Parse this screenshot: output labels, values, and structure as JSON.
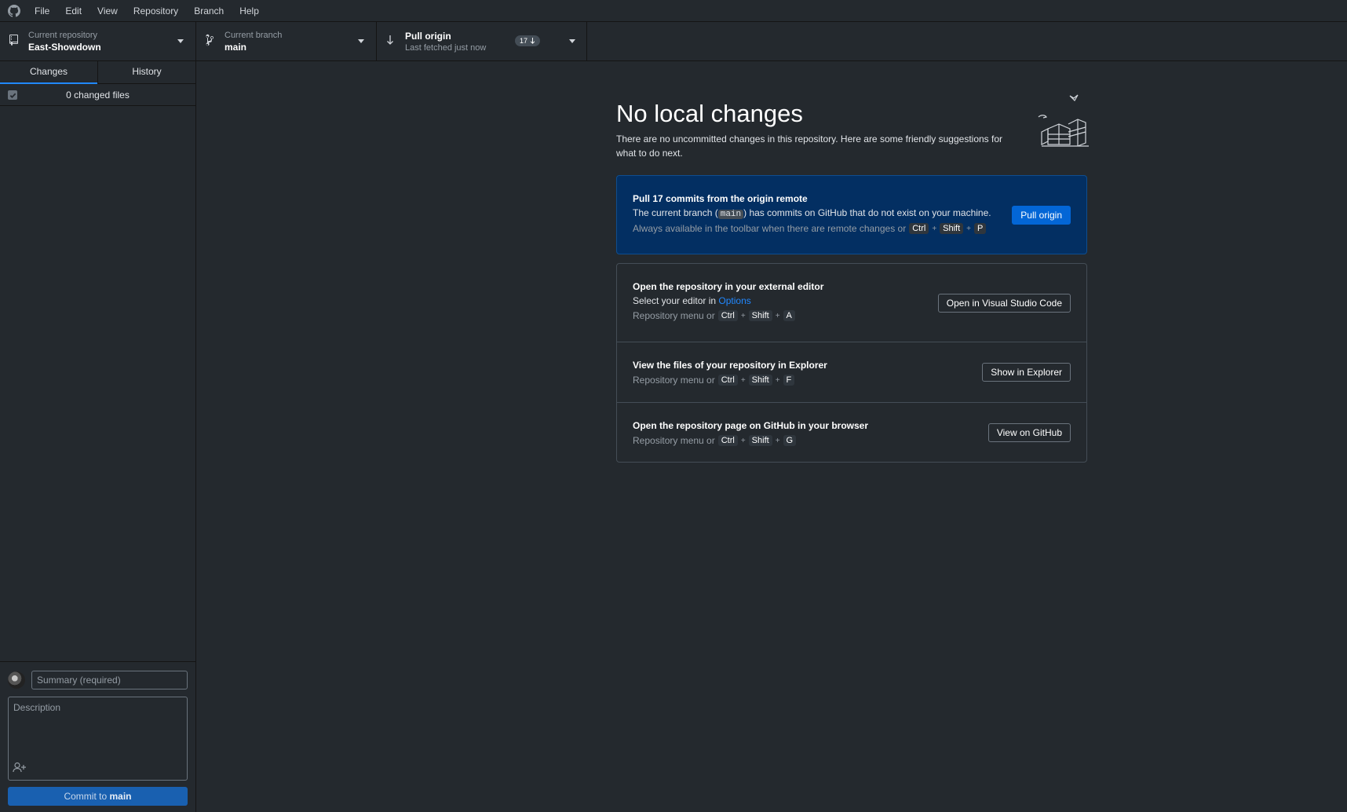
{
  "menubar": {
    "items": [
      "File",
      "Edit",
      "View",
      "Repository",
      "Branch",
      "Help"
    ]
  },
  "toolbar": {
    "repository": {
      "label": "Current repository",
      "value": "East-Showdown",
      "icon": "repo-icon"
    },
    "branch": {
      "label": "Current branch",
      "value": "main",
      "icon": "git-branch-icon"
    },
    "pull": {
      "label": "Pull origin",
      "sublabel": "Last fetched just now",
      "badge_count": "17",
      "icon": "arrow-down-icon"
    }
  },
  "sidebar": {
    "tabs": [
      {
        "label": "Changes",
        "active": true
      },
      {
        "label": "History",
        "active": false
      }
    ],
    "changed_files": "0 changed files",
    "commit": {
      "summary_placeholder": "Summary (required)",
      "description_placeholder": "Description",
      "button_prefix": "Commit to",
      "button_branch": "main"
    }
  },
  "main": {
    "title": "No local changes",
    "description": "There are no uncommitted changes in this repository. Here are some friendly suggestions for what to do next.",
    "pull_card": {
      "title": "Pull 17 commits from the origin remote",
      "desc_before": "The current branch (",
      "branch": "main",
      "desc_after": ") has commits on GitHub that do not exist on your machine.",
      "hint": "Always available in the toolbar when there are remote changes or",
      "keys": [
        "Ctrl",
        "Shift",
        "P"
      ],
      "button": "Pull origin"
    },
    "editor_card": {
      "title": "Open the repository in your external editor",
      "desc_before": "Select your editor in",
      "desc_link": "Options",
      "hint": "Repository menu or",
      "keys": [
        "Ctrl",
        "Shift",
        "A"
      ],
      "button": "Open in Visual Studio Code"
    },
    "explorer_card": {
      "title": "View the files of your repository in Explorer",
      "hint": "Repository menu or",
      "keys": [
        "Ctrl",
        "Shift",
        "F"
      ],
      "button": "Show in Explorer"
    },
    "github_card": {
      "title": "Open the repository page on GitHub in your browser",
      "hint": "Repository menu or",
      "keys": [
        "Ctrl",
        "Shift",
        "G"
      ],
      "button": "View on GitHub"
    }
  },
  "colors": {
    "background": "#24292e",
    "accent": "#0366d6",
    "pull_card_bg": "#032f62",
    "link": "#2188ff"
  }
}
